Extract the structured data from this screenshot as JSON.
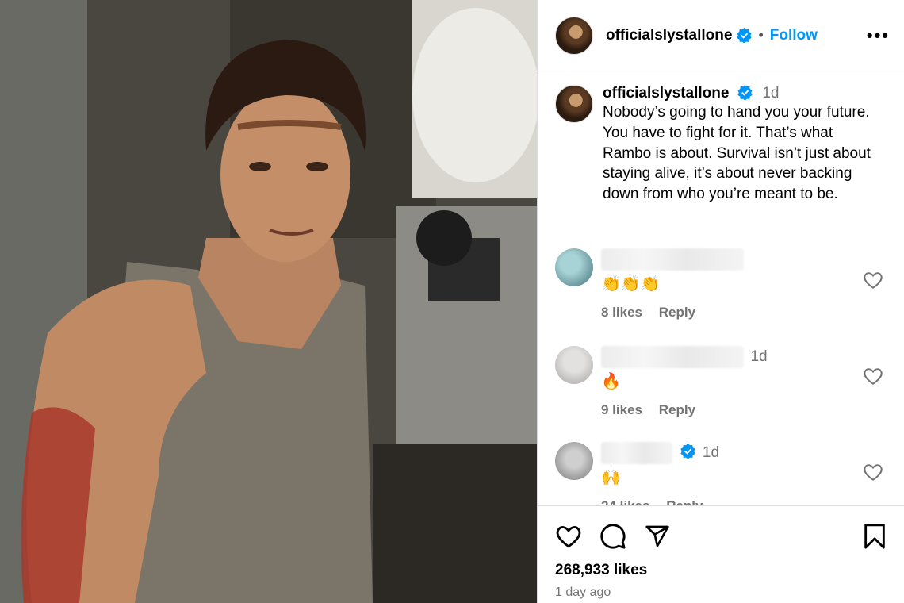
{
  "post": {
    "username": "officialslystallone",
    "follow_label": "Follow",
    "more_label": "•••",
    "dot": "•",
    "caption_time": "1d",
    "caption_text": "Nobody’s going to hand you your future. You have to fight for it. That’s what Rambo is about. Survival isn’t just about staying alive, it’s about never backing down from who you’re meant to be.",
    "likes": "268,933 likes",
    "posted_ago": "1 day ago"
  },
  "comments": [
    {
      "time": "",
      "emoji": "👏👏👏",
      "likes": "8 likes",
      "reply": "Reply"
    },
    {
      "time": "1d",
      "emoji": "🔥",
      "likes": "9 likes",
      "reply": "Reply"
    },
    {
      "time": "1d",
      "emoji": "🙌",
      "likes": "24 likes",
      "reply": "Reply"
    }
  ],
  "colors": {
    "accent": "#0095f6",
    "verified": "#0095f6",
    "muted": "#737373"
  },
  "icons": [
    "verified-badge-icon",
    "more-options-icon",
    "heart-icon",
    "comment-icon",
    "share-icon",
    "bookmark-icon"
  ]
}
